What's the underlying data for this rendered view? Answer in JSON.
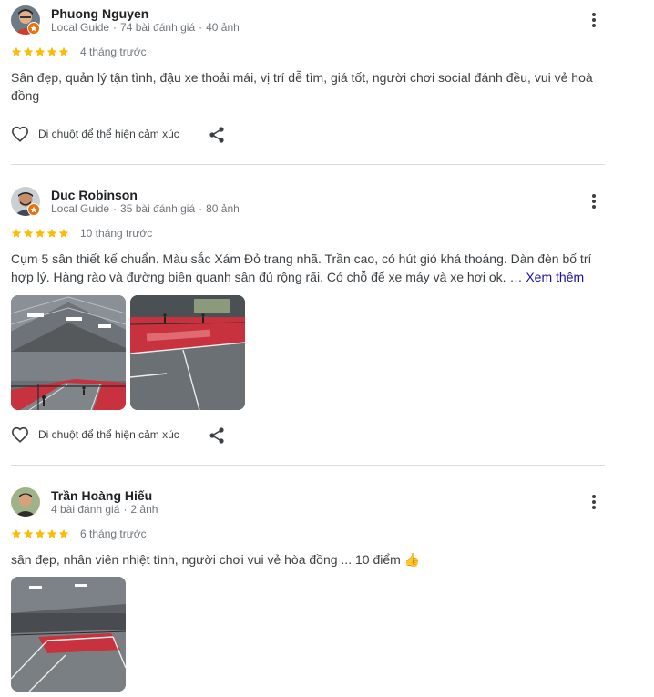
{
  "reviews": [
    {
      "name": "Phuong Nguyen",
      "guide": "Local Guide",
      "reviews_count": "74 bài đánh giá",
      "photos_count": "40 ảnh",
      "rating": 5,
      "time": "4 tháng trước",
      "text": "Sân đẹp, quản lý tận tình, đậu xe thoải mái, vị trí dễ tìm, giá tốt, người chơi social đánh đều, vui vẻ hoà đồng",
      "react_label": "Di chuột để thể hiện cảm xúc"
    },
    {
      "name": "Duc Robinson",
      "guide": "Local Guide",
      "reviews_count": "35 bài đánh giá",
      "photos_count": "80 ảnh",
      "rating": 5,
      "time": "10 tháng trước",
      "text": "Cụm 5 sân thiết kế chuẩn. Màu sắc Xám Đỏ trang nhã. Trần cao, có hút gió khá thoáng. Dàn đèn bố trí hợp lý. Hàng rào và đường biên quanh sân đủ rộng rãi. Có chỗ để xe máy và xe hơi ok. …",
      "more_link": "Xem thêm",
      "react_label": "Di chuột để thể hiện cảm xúc"
    },
    {
      "name": "Trần Hoàng Hiếu",
      "reviews_count": "4 bài đánh giá",
      "photos_count": "2 ảnh",
      "rating": 5,
      "time": "6 tháng trước",
      "text": "sân đẹp, nhân viên nhiệt tình, người chơi vui vẻ hòa đồng ... 10 điểm",
      "emoji": "👍"
    }
  ],
  "icons": {
    "more": "more-vert-icon",
    "heart": "heart-outline-icon",
    "share": "share-icon",
    "star": "star-icon",
    "badge": "local-guide-badge-icon"
  },
  "colors": {
    "star": "#fbbc04",
    "link": "#1a0dab",
    "badge": "#e8710a",
    "court_red": "#c8323e",
    "court_gray": "#6f7478"
  }
}
